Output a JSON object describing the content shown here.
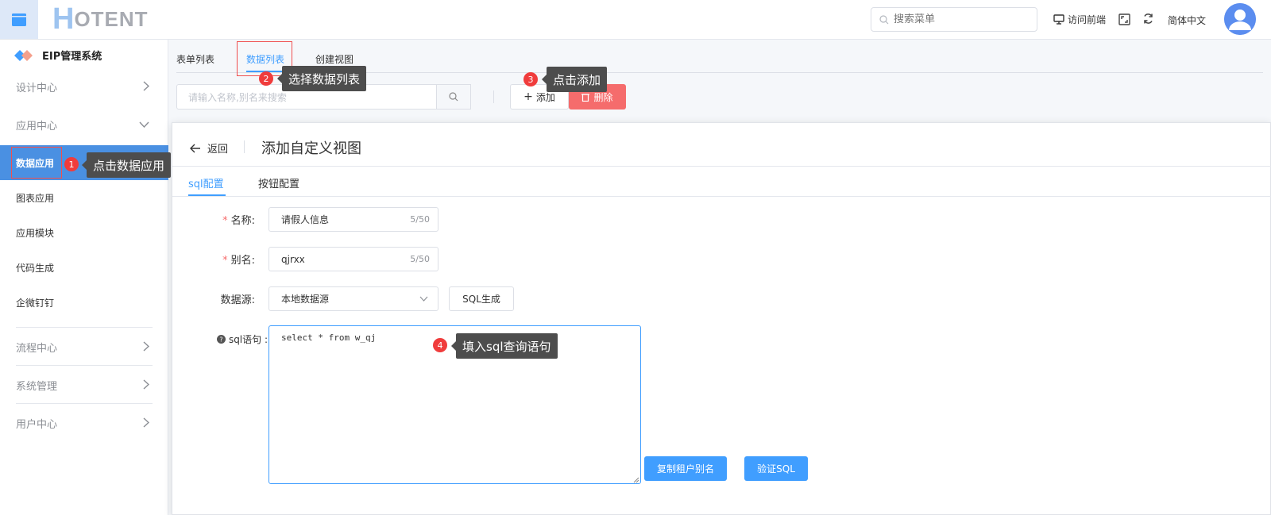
{
  "header": {
    "logo_h": "H",
    "logo_rest": "OTENT",
    "search_placeholder": "搜索菜单",
    "visit_front": "访问前端",
    "language": "简体中文"
  },
  "sidebar": {
    "system_title": "EIP管理系统",
    "design_center": "设计中心",
    "app_center": "应用中心",
    "sub_items": [
      "数据应用",
      "图表应用",
      "应用模块",
      "代码生成",
      "企微钉钉"
    ],
    "flow_center": "流程中心",
    "system_manage": "系统管理",
    "user_center": "用户中心"
  },
  "main": {
    "tabs": [
      "表单列表",
      "数据列表",
      "创建视图"
    ],
    "filter_placeholder": "请输入名称,别名来搜索",
    "add_label": "添加",
    "delete_label": "删除"
  },
  "panel": {
    "back_label": "返回",
    "title": "添加自定义视图",
    "tabs": [
      "sql配置",
      "按钮配置"
    ],
    "name_label": "名称:",
    "name_value": "请假人信息",
    "name_count": "5/50",
    "alias_label": "别名:",
    "alias_value": "qjrxx",
    "alias_count": "5/50",
    "datasource_label": "数据源:",
    "datasource_value": "本地数据源",
    "sql_gen_label": "SQL生成",
    "sql_label": "sql语句 :",
    "sql_value": "select * from w_qj",
    "copy_alias_label": "复制租户别名",
    "verify_sql_label": "验证SQL"
  },
  "annotations": [
    {
      "num": "1",
      "text": "点击数据应用"
    },
    {
      "num": "2",
      "text": "选择数据列表"
    },
    {
      "num": "3",
      "text": "点击添加"
    },
    {
      "num": "4",
      "text": "填入sql查询语句"
    }
  ],
  "colors": {
    "accent": "#409eff",
    "danger": "#f56c6c",
    "sidebar_active": "#4a90e2",
    "callout": "#4d4d4d",
    "badge": "#f03c3c"
  }
}
